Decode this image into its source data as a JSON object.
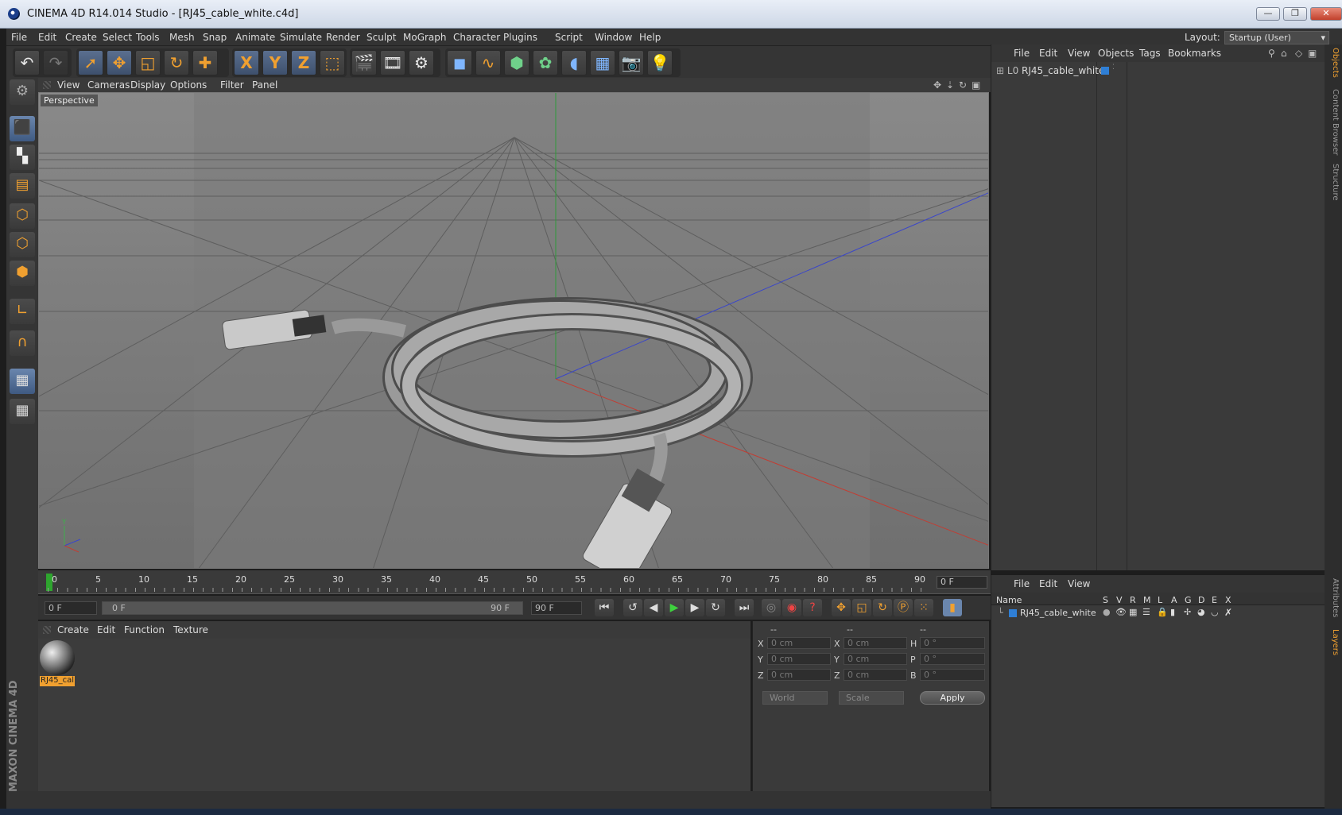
{
  "window": {
    "title": "CINEMA 4D R14.014 Studio - [RJ45_cable_white.c4d]",
    "controls": [
      "—",
      "❐",
      "✕"
    ]
  },
  "menu": {
    "items": [
      "File",
      "Edit",
      "Create",
      "Select",
      "Tools",
      "Mesh",
      "Snap",
      "Animate",
      "Simulate",
      "Render",
      "Sculpt",
      "MoGraph",
      "Character",
      "Plugins",
      "Script",
      "Window",
      "Help"
    ],
    "layout_label": "Layout:",
    "layout_value": "Startup (User)"
  },
  "toolbar": {
    "icons": [
      "undo-icon",
      "redo-icon",
      "live-selection-icon",
      "move-icon",
      "scale-icon",
      "rotate-icon",
      "add-icon",
      "x-axis-icon",
      "y-axis-icon",
      "z-axis-icon",
      "coordinate-system-icon",
      "render-view-icon",
      "render-picture-viewer-icon",
      "render-settings-icon",
      "cube-icon",
      "spline-icon",
      "nurbs-icon",
      "array-icon",
      "deformer-icon",
      "floor-icon",
      "camera-icon",
      "light-icon"
    ],
    "axis_labels": [
      "X",
      "Y",
      "Z"
    ]
  },
  "viewport": {
    "menu": [
      "View",
      "Cameras",
      "Display",
      "Options",
      "Filter",
      "Panel"
    ],
    "label": "Perspective"
  },
  "timeline": {
    "ticks": [
      "0",
      "5",
      "10",
      "15",
      "20",
      "25",
      "30",
      "35",
      "40",
      "45",
      "50",
      "55",
      "60",
      "65",
      "70",
      "75",
      "80",
      "85",
      "90"
    ],
    "end_frame": "0 F"
  },
  "transport": {
    "current": "0 F",
    "range_start": "0 F",
    "range_end": "90 F",
    "max": "90 F"
  },
  "materials": {
    "menu": [
      "Create",
      "Edit",
      "Function",
      "Texture"
    ],
    "items": [
      {
        "name": "RJ45_cal"
      }
    ]
  },
  "coords": {
    "headers": [
      "--",
      "--",
      "--"
    ],
    "rows": [
      {
        "l1": "X",
        "v1": "0 cm",
        "l2": "X",
        "v2": "0 cm",
        "l3": "H",
        "v3": "0 °"
      },
      {
        "l1": "Y",
        "v1": "0 cm",
        "l2": "Y",
        "v2": "0 cm",
        "l3": "P",
        "v3": "0 °"
      },
      {
        "l1": "Z",
        "v1": "0 cm",
        "l2": "Z",
        "v2": "0 cm",
        "l3": "B",
        "v3": "0 °"
      }
    ],
    "mode1": "World",
    "mode2": "Scale",
    "apply": "Apply"
  },
  "objects": {
    "menu": [
      "File",
      "Edit",
      "View",
      "Objects",
      "Tags",
      "Bookmarks"
    ],
    "tree": [
      {
        "name": "RJ45_cable_white",
        "layer_color": "#2f7fd6"
      }
    ]
  },
  "layers": {
    "menu": [
      "File",
      "Edit",
      "View"
    ],
    "columns": [
      "Name",
      "S",
      "V",
      "R",
      "M",
      "L",
      "A",
      "G",
      "D",
      "E",
      "X"
    ],
    "rows": [
      {
        "name": "RJ45_cable_white",
        "color": "#2f7fd6"
      }
    ]
  },
  "side_tabs": [
    "Objects",
    "Content Browser",
    "Structure",
    "Attributes",
    "Layers"
  ],
  "brand": "MAXON CINEMA 4D"
}
